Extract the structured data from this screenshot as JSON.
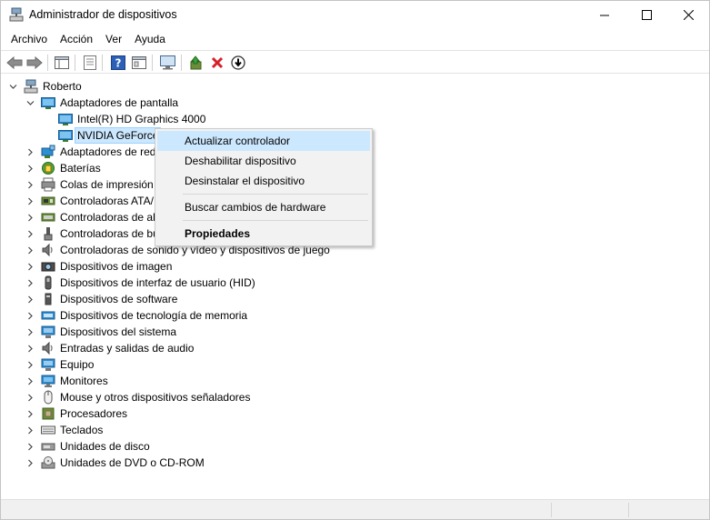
{
  "window": {
    "title": "Administrador de dispositivos"
  },
  "menubar": {
    "items": [
      "Archivo",
      "Acción",
      "Ver",
      "Ayuda"
    ]
  },
  "tree": {
    "root": "Roberto",
    "display_adapters": "Adaptadores de pantalla",
    "display_children": [
      "Intel(R) HD Graphics 4000",
      "NVIDIA GeForce"
    ],
    "categories": [
      "Adaptadores de red",
      "Baterías",
      "Colas de impresión",
      "Controladoras ATA/",
      "Controladoras de al",
      "Controladoras de bu",
      "Controladoras de sonido y vídeo y dispositivos de juego",
      "Dispositivos de imagen",
      "Dispositivos de interfaz de usuario (HID)",
      "Dispositivos de software",
      "Dispositivos de tecnología de memoria",
      "Dispositivos del sistema",
      "Entradas y salidas de audio",
      "Equipo",
      "Monitores",
      "Mouse y otros dispositivos señaladores",
      "Procesadores",
      "Teclados",
      "Unidades de disco",
      "Unidades de DVD o CD-ROM"
    ]
  },
  "context_menu": {
    "update_driver": "Actualizar controlador",
    "disable_device": "Deshabilitar dispositivo",
    "uninstall_device": "Desinstalar el dispositivo",
    "scan_hardware": "Buscar cambios de hardware",
    "properties": "Propiedades"
  }
}
